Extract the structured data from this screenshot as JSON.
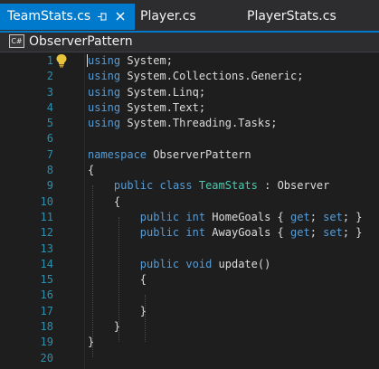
{
  "tabs": [
    {
      "label": "TeamStats.cs",
      "active": true,
      "pin_icon": "pin-icon",
      "close_icon": "close-icon"
    },
    {
      "label": "Player.cs",
      "active": false
    },
    {
      "label": "PlayerStats.cs",
      "active": false
    }
  ],
  "navbar": {
    "icon": "csharp-file-icon",
    "icon_text": "C#",
    "label": "ObserverPattern"
  },
  "editor": {
    "lightbulb_icon": "lightbulb-icon",
    "lines": [
      {
        "n": "1",
        "tokens": [
          {
            "t": "using",
            "c": "kw"
          },
          {
            "t": " System;"
          }
        ]
      },
      {
        "n": "2",
        "tokens": [
          {
            "t": "using",
            "c": "kw"
          },
          {
            "t": " System.Collections.Generic;"
          }
        ]
      },
      {
        "n": "3",
        "tokens": [
          {
            "t": "using",
            "c": "kw"
          },
          {
            "t": " System.Linq;"
          }
        ]
      },
      {
        "n": "4",
        "tokens": [
          {
            "t": "using",
            "c": "kw"
          },
          {
            "t": " System.Text;"
          }
        ]
      },
      {
        "n": "5",
        "tokens": [
          {
            "t": "using",
            "c": "kw"
          },
          {
            "t": " System.Threading.Tasks;"
          }
        ]
      },
      {
        "n": "6",
        "tokens": []
      },
      {
        "n": "7",
        "tokens": [
          {
            "t": "namespace",
            "c": "kw"
          },
          {
            "t": " ObserverPattern"
          }
        ]
      },
      {
        "n": "8",
        "tokens": [
          {
            "t": "{"
          }
        ]
      },
      {
        "n": "9",
        "tokens": [
          {
            "t": "    "
          },
          {
            "t": "public",
            "c": "kw"
          },
          {
            "t": " "
          },
          {
            "t": "class",
            "c": "kw"
          },
          {
            "t": " "
          },
          {
            "t": "TeamStats",
            "c": "type"
          },
          {
            "t": " : Observer"
          }
        ]
      },
      {
        "n": "10",
        "tokens": [
          {
            "t": "    {"
          }
        ]
      },
      {
        "n": "11",
        "tokens": [
          {
            "t": "        "
          },
          {
            "t": "public",
            "c": "kw"
          },
          {
            "t": " "
          },
          {
            "t": "int",
            "c": "kw"
          },
          {
            "t": " HomeGoals { "
          },
          {
            "t": "get",
            "c": "kw"
          },
          {
            "t": "; "
          },
          {
            "t": "set",
            "c": "kw"
          },
          {
            "t": "; }"
          }
        ]
      },
      {
        "n": "12",
        "tokens": [
          {
            "t": "        "
          },
          {
            "t": "public",
            "c": "kw"
          },
          {
            "t": " "
          },
          {
            "t": "int",
            "c": "kw"
          },
          {
            "t": " AwayGoals { "
          },
          {
            "t": "get",
            "c": "kw"
          },
          {
            "t": "; "
          },
          {
            "t": "set",
            "c": "kw"
          },
          {
            "t": "; }"
          }
        ]
      },
      {
        "n": "13",
        "tokens": []
      },
      {
        "n": "14",
        "tokens": [
          {
            "t": "        "
          },
          {
            "t": "public",
            "c": "kw"
          },
          {
            "t": " "
          },
          {
            "t": "void",
            "c": "kw"
          },
          {
            "t": " update()"
          }
        ]
      },
      {
        "n": "15",
        "tokens": [
          {
            "t": "        {"
          }
        ]
      },
      {
        "n": "16",
        "tokens": []
      },
      {
        "n": "17",
        "tokens": [
          {
            "t": "        }"
          }
        ]
      },
      {
        "n": "18",
        "tokens": [
          {
            "t": "    }"
          }
        ]
      },
      {
        "n": "19",
        "tokens": [
          {
            "t": "}"
          }
        ]
      },
      {
        "n": "20",
        "tokens": []
      }
    ]
  },
  "colors": {
    "accent": "#007acc",
    "background": "#1e1e1e",
    "line_number": "#2b91af",
    "keyword": "#569cd6",
    "type": "#4ec9b0",
    "text": "#dcdcdc"
  }
}
